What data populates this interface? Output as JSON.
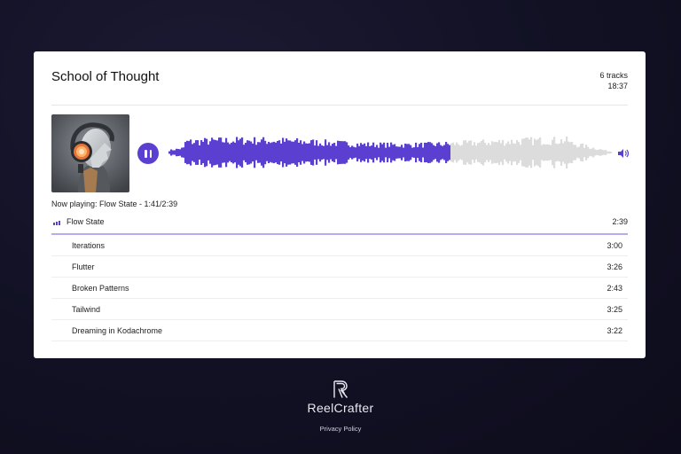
{
  "album": {
    "title": "School of Thought",
    "track_count": "6 tracks",
    "total_duration": "18:37"
  },
  "player": {
    "now_playing": "Now playing: Flow State - 1:41/2:39",
    "progress": 0.635,
    "accent_color": "#5b3fd1",
    "played_color": "#5b3fd1",
    "unplayed_color": "#dcdcdc",
    "play_state_icon": "pause-icon",
    "volume_icon": "speaker-icon"
  },
  "tracks": [
    {
      "name": "Flow State",
      "duration": "2:39",
      "current": true
    },
    {
      "name": "Iterations",
      "duration": "3:00"
    },
    {
      "name": "Flutter",
      "duration": "3:26"
    },
    {
      "name": "Broken Patterns",
      "duration": "2:43"
    },
    {
      "name": "Tailwind",
      "duration": "3:25"
    },
    {
      "name": "Dreaming in Kodachrome",
      "duration": "3:22"
    }
  ],
  "footer": {
    "brand": "ReelCrafter",
    "privacy_link": "Privacy Policy"
  }
}
